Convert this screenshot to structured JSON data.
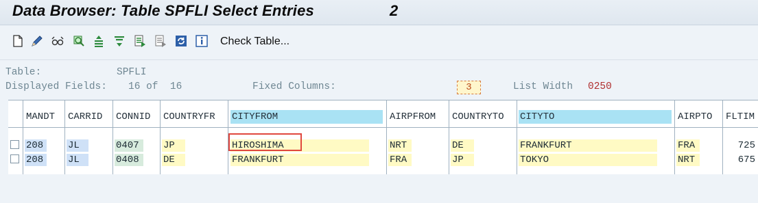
{
  "window": {
    "title": "Data Browser: Table SPFLI Select Entries",
    "count": "2"
  },
  "toolbar": {
    "icons": [
      "new-document-icon",
      "edit-pencil-icon",
      "display-glasses-icon",
      "find-icon",
      "sort-ascending-icon",
      "filter-icon",
      "select-all-icon",
      "deselect-icon",
      "refresh-icon",
      "info-icon"
    ],
    "check_table": "Check Table..."
  },
  "info": {
    "table_label": "Table:",
    "table_value": "SPFLI",
    "fields_label": "Displayed Fields:",
    "fields_value": "16 of  16",
    "fixed_label": "Fixed Columns:",
    "fixed_value": "3",
    "listwidth_label": "List Width",
    "listwidth_value": "0250"
  },
  "columns": [
    "MANDT",
    "CARRID",
    "CONNID",
    "COUNTRYFR",
    "CITYFROM",
    "AIRPFROM",
    "COUNTRYTO",
    "CITYTO",
    "AIRPTO",
    "FLTIM"
  ],
  "rows": [
    {
      "mandt": "208",
      "carrid": "JL",
      "connid": "0407",
      "countryfr": "JP",
      "cityfrom": "HIROSHIMA",
      "airpfrom": "NRT",
      "countryto": "DE",
      "cityto": "FRANKFURT",
      "airpto": "FRA",
      "fltime": "725"
    },
    {
      "mandt": "208",
      "carrid": "JL",
      "connid": "0408",
      "countryfr": "DE",
      "cityfrom": "FRANKFURT",
      "airpfrom": "FRA",
      "countryto": "JP",
      "cityto": "TOKYO",
      "airpto": "NRT",
      "fltime": "675"
    }
  ]
}
